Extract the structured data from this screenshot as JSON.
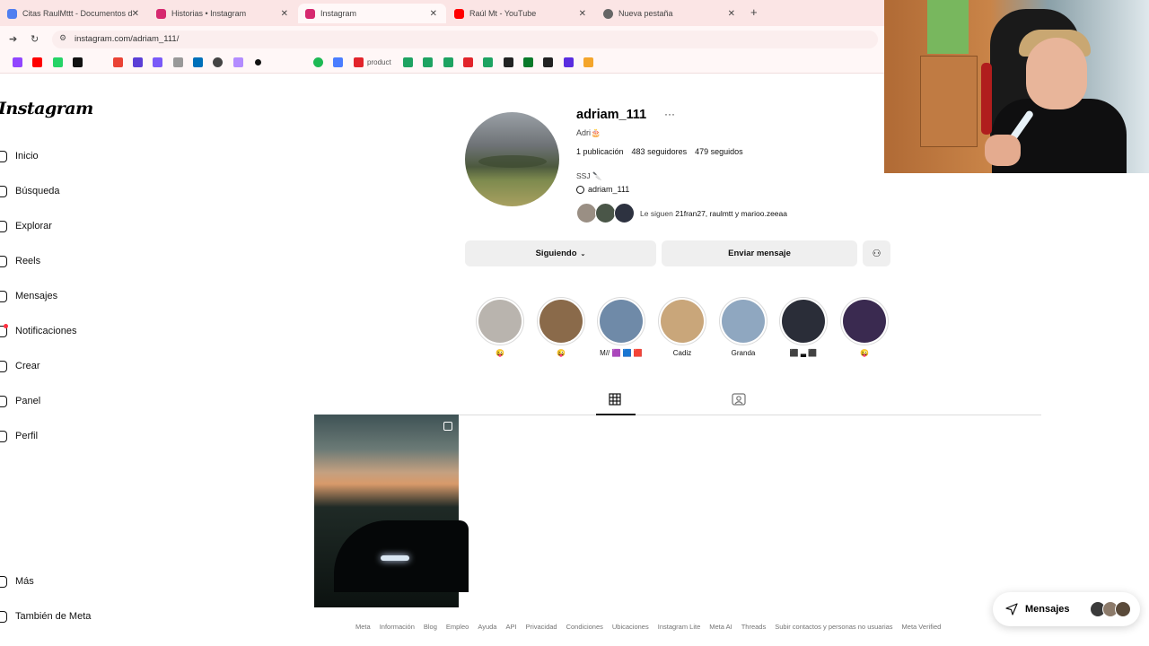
{
  "browser": {
    "tabs": [
      {
        "title": "Citas RaulMttt - Documentos d",
        "color": "#4f7ef0"
      },
      {
        "title": "Historias • Instagram",
        "color": "#d6296f"
      },
      {
        "title": "Instagram",
        "color": "#d6296f"
      },
      {
        "title": "Raúl Mt - YouTube",
        "color": "#ff0000"
      },
      {
        "title": "Nueva pestaña",
        "color": "#666666"
      }
    ],
    "new_tab_label": "+",
    "url": "instagram.com/adriam_111/",
    "bookmark_text": "product"
  },
  "sidebar": {
    "logo": "Instagram",
    "items": [
      {
        "label": "Inicio"
      },
      {
        "label": "Búsqueda"
      },
      {
        "label": "Explorar"
      },
      {
        "label": "Reels"
      },
      {
        "label": "Mensajes"
      },
      {
        "label": "Notificaciones"
      },
      {
        "label": "Crear"
      },
      {
        "label": "Panel"
      },
      {
        "label": "Perfil"
      }
    ],
    "bottom_items": [
      {
        "label": "Más"
      },
      {
        "label": "También de Meta"
      }
    ]
  },
  "profile": {
    "username": "adriam_111",
    "more": "···",
    "fullname": "Adri🎂",
    "posts": "1 publicación",
    "followers": "483 seguidores",
    "following": "479 seguidos",
    "bio": "SSJ 🔪",
    "threads": "adriam_111",
    "followed_by_prefix": "Le siguen",
    "followed_by": "21fran27, raulmtt y marioo.zeeaa",
    "follow_button": "Siguiendo",
    "message_button": "Enviar mensaje"
  },
  "highlights": [
    {
      "label": "😜",
      "color": "#b9b4ae"
    },
    {
      "label": "😜",
      "color": "#8a6a4a"
    },
    {
      "label": "M// 🟪 🟦 🟥",
      "color": "#6f8aa8"
    },
    {
      "label": "Cadiz",
      "color": "#c9a67a"
    },
    {
      "label": "Granda",
      "color": "#8fa7c0"
    },
    {
      "label": "⬛ ▃ ⬛",
      "color": "#2a2d38"
    },
    {
      "label": "😜",
      "color": "#3a2a50"
    }
  ],
  "footer": [
    "Meta",
    "Información",
    "Blog",
    "Empleo",
    "Ayuda",
    "API",
    "Privacidad",
    "Condiciones",
    "Ubicaciones",
    "Instagram Lite",
    "Meta AI",
    "Threads",
    "Subir contactos y personas no usuarias",
    "Meta Verified"
  ],
  "messages_pill": {
    "label": "Mensajes"
  }
}
